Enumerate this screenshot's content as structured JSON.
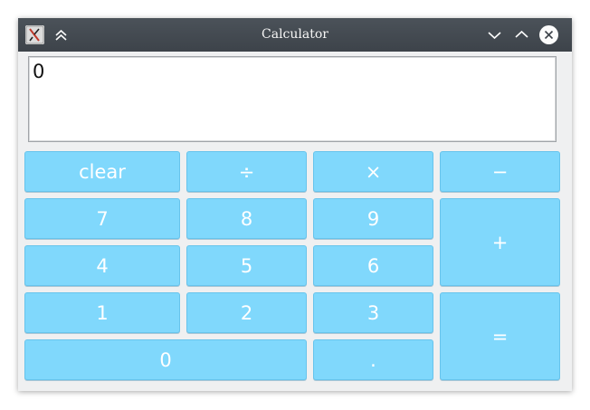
{
  "window": {
    "title": "Calculator"
  },
  "display": {
    "value": "0"
  },
  "buttons": {
    "clear": "clear",
    "divide": "÷",
    "multiply": "×",
    "subtract": "−",
    "seven": "7",
    "eight": "8",
    "nine": "9",
    "add": "+",
    "four": "4",
    "five": "5",
    "six": "6",
    "one": "1",
    "two": "2",
    "three": "3",
    "equals": "=",
    "zero": "0",
    "decimal": "."
  },
  "colors": {
    "button_fill": "#80d8fc",
    "titlebar": "#454b52"
  },
  "icons": {
    "app": "calculator-app-icon",
    "keep_above": "keep-above-icon",
    "minimize": "minimize-icon",
    "maximize": "maximize-icon",
    "close": "close-icon"
  }
}
